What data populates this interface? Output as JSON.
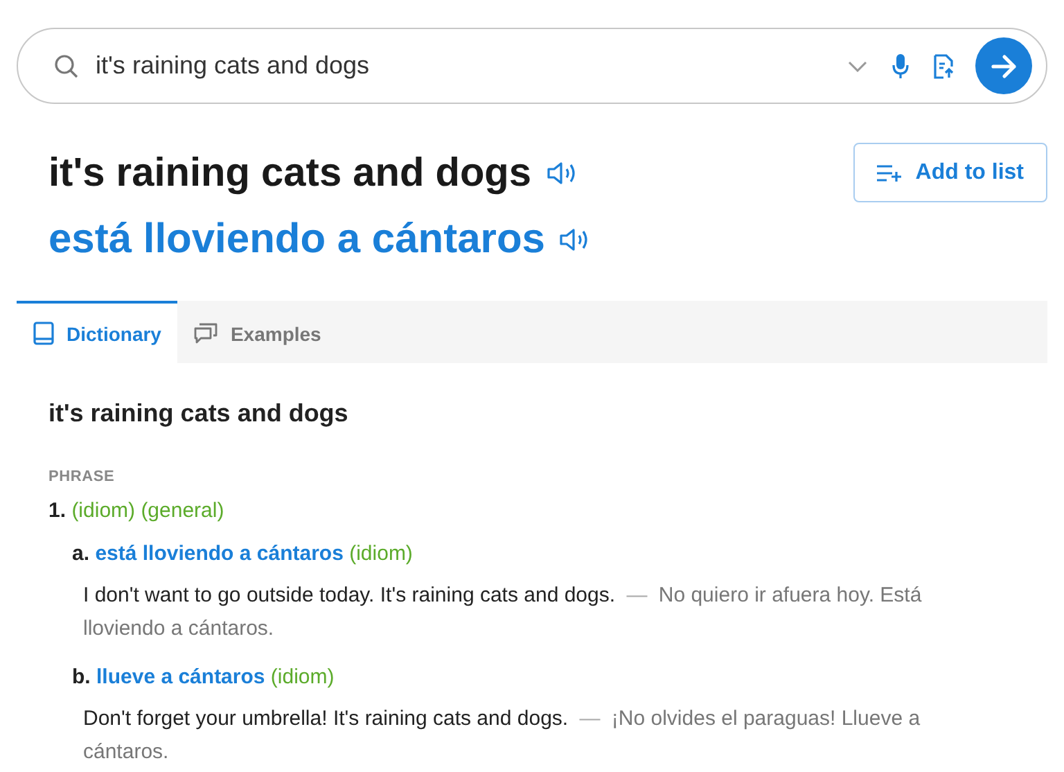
{
  "search": {
    "value": "it's raining cats and dogs"
  },
  "headword": "it's raining cats and dogs",
  "translation": "está lloviendo a cántaros",
  "add_button": "Add to list",
  "tabs": [
    {
      "label": "Dictionary",
      "selected": true
    },
    {
      "label": "Examples",
      "selected": false
    }
  ],
  "entry": {
    "title": "it's raining cats and dogs",
    "part_of_speech": "PHRASE",
    "senses": [
      {
        "number": "1.",
        "tags": "(idiom) (general)",
        "translations": [
          {
            "letter": "a.",
            "text": "está lloviendo a cántaros",
            "tag": "(idiom)",
            "example": "I don't want to go outside today. It's raining cats and dogs.",
            "separator": "—",
            "example_translation": "No quiero ir afuera hoy. Está lloviendo a cántaros."
          },
          {
            "letter": "b.",
            "text": "llueve a cántaros",
            "tag": "(idiom)",
            "example": "Don't forget your umbrella! It's raining cats and dogs.",
            "separator": "—",
            "example_translation": "¡No olvides el paraguas! Llueve a cántaros."
          }
        ]
      }
    ]
  }
}
